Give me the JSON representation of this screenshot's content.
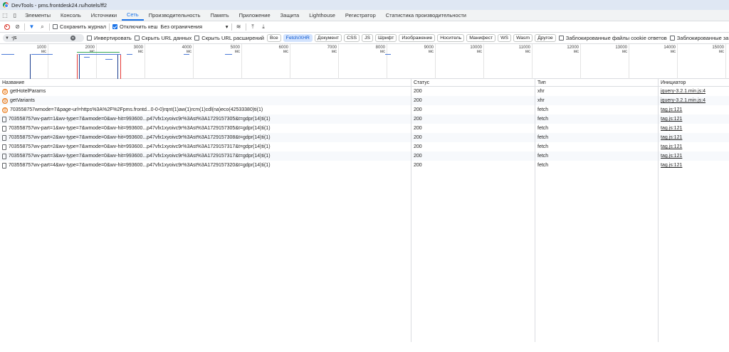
{
  "window": {
    "title": "DevTools - pms.frontdesk24.ru/hotels/ff2"
  },
  "tabs": [
    "Элементы",
    "Консоль",
    "Источники",
    "Сеть",
    "Производительность",
    "Память",
    "Приложение",
    "Защита",
    "Lighthouse",
    "Регистратор",
    "Статистика производительности"
  ],
  "active_tab": "Сеть",
  "toolbar": {
    "preserve_log": "Сохранить журнал",
    "disable_cache": "Отключить кеш",
    "throttle": "Без ограничения"
  },
  "filter": {
    "value": "-js",
    "invert": "Инвертировать",
    "hide_data_urls": "Скрыть URL данных",
    "hide_ext_urls": "Скрыть URL расширений",
    "types": [
      "Все",
      "Fetch/XHR",
      "Документ",
      "CSS",
      "JS",
      "Шрифт",
      "Изображение",
      "Носитель",
      "Манифест",
      "WS",
      "Wasm",
      "Другое"
    ],
    "active_type": "Fetch/XHR",
    "blocked_cookies": "Заблокированные файлы cookie ответов",
    "blocked_requests": "Заблокированные за"
  },
  "timeline": {
    "ticks": [
      "1000 мс",
      "2000 мс",
      "3000 мс",
      "4000 мс",
      "5000 мс",
      "6000 мс",
      "7000 мс",
      "8000 мс",
      "9000 мс",
      "10000 мс",
      "11000 мс",
      "12000 мс",
      "13000 мс",
      "14000 мс",
      "15000 мс"
    ]
  },
  "table": {
    "headers": {
      "name": "Название",
      "status": "Статус",
      "type": "Тип",
      "initiator": "Инициатор"
    },
    "rows": [
      {
        "icon": "xhr",
        "name": "getHotelParams",
        "status": "200",
        "type": "xhr",
        "initiator": "jquery-3.2.1.min.js:4"
      },
      {
        "icon": "xhr",
        "name": "getVariants",
        "status": "200",
        "type": "xhr",
        "initiator": "jquery-3.2.1.min.js:4"
      },
      {
        "icon": "xhr",
        "name": "703558757wmode=7&page-url=https%3A%2F%2Fpms.frontd...0-0-0)rqnt(1)aw(1)rcm(1)cdl(na)eco(42533380)ti(1)",
        "status": "200",
        "type": "fetch",
        "initiator": "tag.js:121"
      },
      {
        "icon": "doc",
        "name": "703558757wv-part=1&wv-type=7&wmode=0&wv-hit=993600...p47vfx1xyoivc9r%3Ast%3A1729157305&t=gdpr(14)ti(1)",
        "status": "200",
        "type": "fetch",
        "initiator": "tag.js:121"
      },
      {
        "icon": "doc",
        "name": "703558757wv-part=1&wv-type=7&wmode=0&wv-hit=993600...p47vfx1xyoivc9r%3Ast%3A1729157305&t=gdpr(14)ti(1)",
        "status": "200",
        "type": "fetch",
        "initiator": "tag.js:121"
      },
      {
        "icon": "doc",
        "name": "703558757wv-part=2&wv-type=7&wmode=0&wv-hit=993600...p47vfx1xyoivc9r%3Ast%3A1729157308&t=gdpr(14)ti(1)",
        "status": "200",
        "type": "fetch",
        "initiator": "tag.js:121"
      },
      {
        "icon": "doc",
        "name": "703558757wv-part=2&wv-type=7&wmode=0&wv-hit=993600...p47vfx1xyoivc9r%3Ast%3A1729157317&t=gdpr(14)ti(1)",
        "status": "200",
        "type": "fetch",
        "initiator": "tag.js:121"
      },
      {
        "icon": "doc",
        "name": "703558757wv-part=3&wv-type=7&wmode=0&wv-hit=993600...p47vfx1xyoivc9r%3Ast%3A1729157317&t=gdpr(14)ti(1)",
        "status": "200",
        "type": "fetch",
        "initiator": "tag.js:121"
      },
      {
        "icon": "doc",
        "name": "703558757wv-part=4&wv-type=7&wmode=0&wv-hit=993600...p47vfx1xyoivc9r%3Ast%3A1729157320&t=gdpr(14)ti(1)",
        "status": "200",
        "type": "fetch",
        "initiator": "tag.js:121"
      }
    ]
  }
}
